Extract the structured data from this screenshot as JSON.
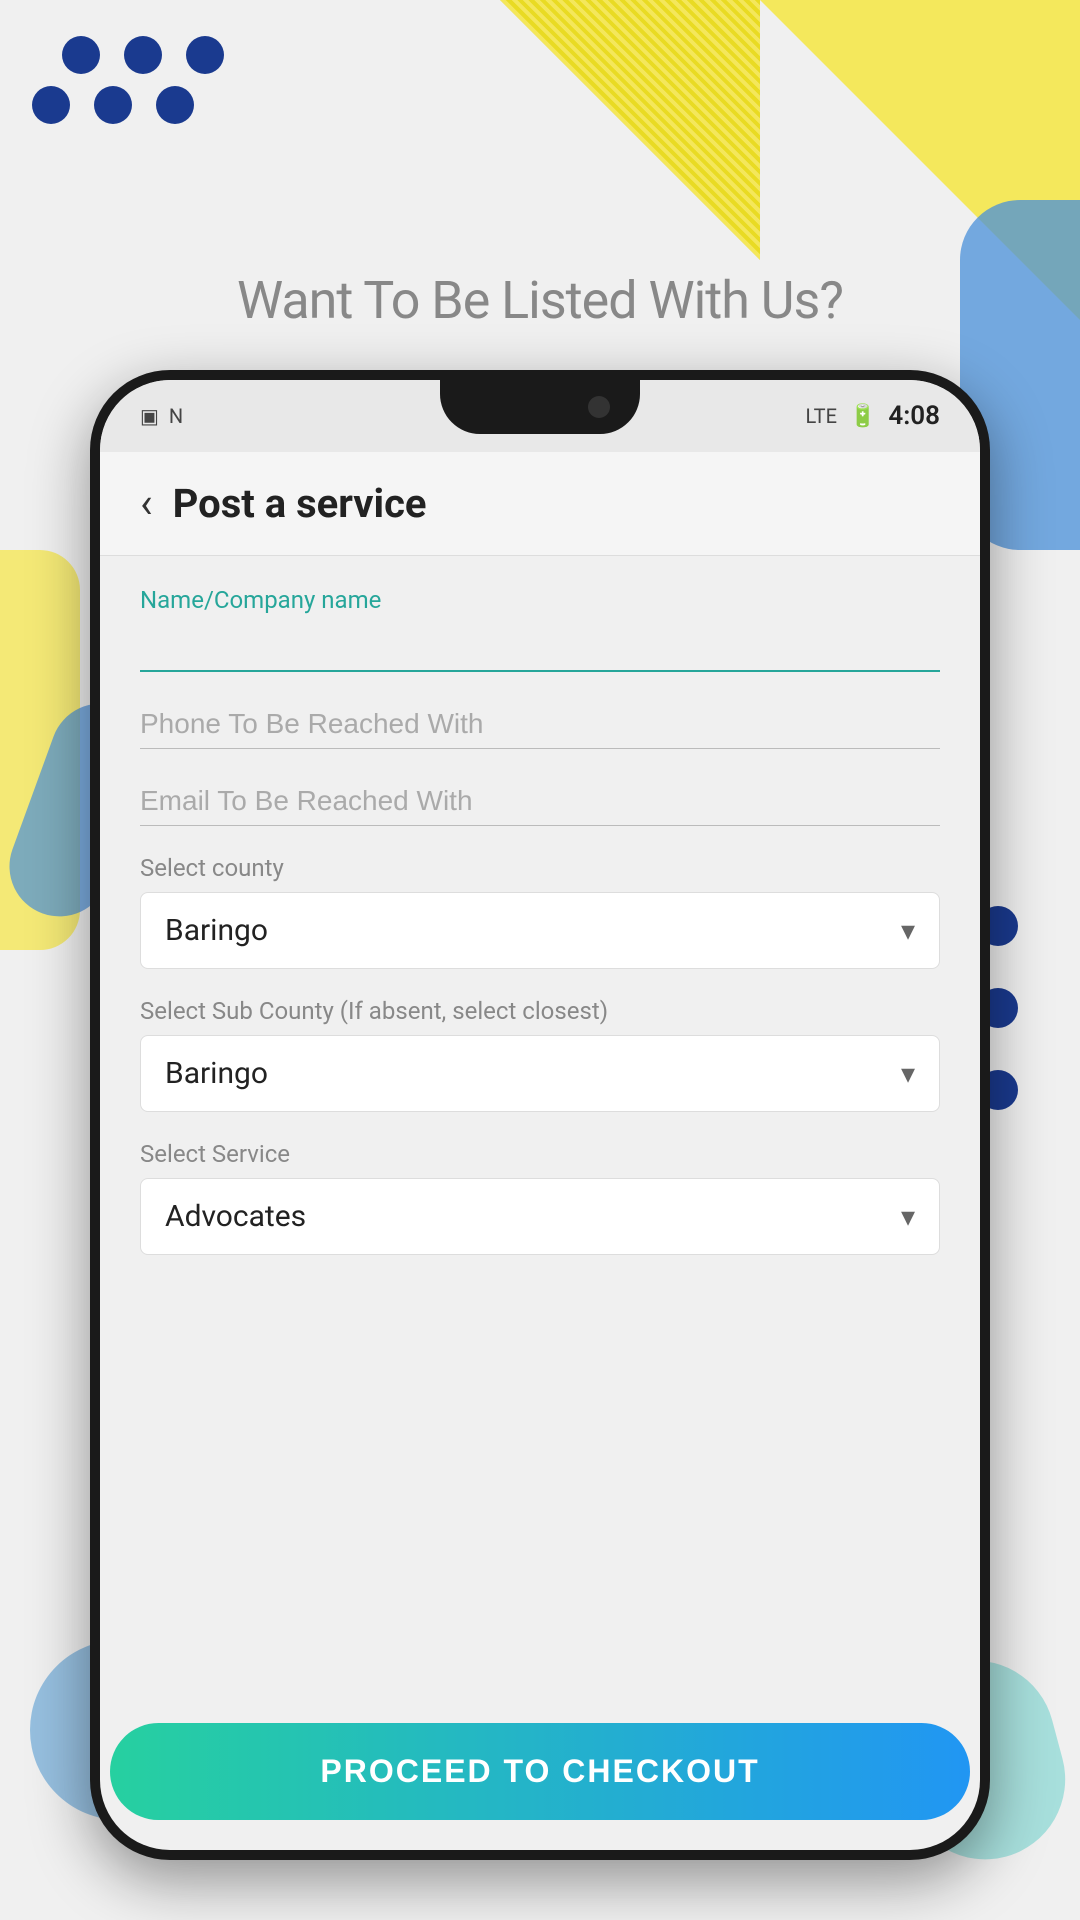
{
  "background": {
    "dots_color": "#1a3a8f",
    "accent_yellow": "#f5e642",
    "accent_blue": "#4a90d9",
    "accent_teal": "#5ecec8"
  },
  "page": {
    "title": "Want To Be Listed With Us?"
  },
  "status_bar": {
    "time": "4:08",
    "signal": "LTE",
    "battery": "⚡"
  },
  "header": {
    "back_label": "‹",
    "title": "Post a service"
  },
  "form": {
    "name_label": "Name/Company name",
    "name_value": "",
    "phone_placeholder": "Phone To Be Reached With",
    "email_placeholder": "Email To Be Reached With",
    "county_label": "Select county",
    "county_value": "Baringo",
    "sub_county_label": "Select Sub County (If absent, select closest)",
    "sub_county_value": "Baringo",
    "service_label": "Select Service",
    "service_value": "Advocates"
  },
  "button": {
    "proceed_label": "PROCEED TO CHECKOUT"
  }
}
